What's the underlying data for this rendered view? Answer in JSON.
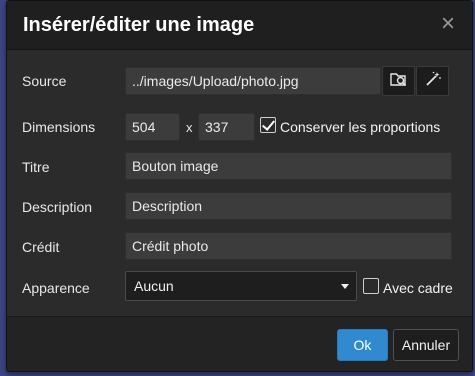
{
  "dialog": {
    "title": "Insérer/éditer une image",
    "close_icon": "×"
  },
  "form": {
    "source": {
      "label": "Source",
      "value": "../images/Upload/photo.jpg",
      "browse_icon": "folder-search-icon",
      "magic_icon": "magic-wand-icon"
    },
    "dimensions": {
      "label": "Dimensions",
      "width": "504",
      "separator": "x",
      "height": "337",
      "keep_ratio_label": "Conserver les proportions",
      "keep_ratio_checked": true
    },
    "title": {
      "label": "Titre",
      "value": "Bouton image"
    },
    "description": {
      "label": "Description",
      "value": "Description"
    },
    "credit": {
      "label": "Crédit",
      "value": "Crédit photo"
    },
    "appearance": {
      "label": "Apparence",
      "selected": "Aucun",
      "frame_label": "Avec cadre",
      "frame_checked": false
    }
  },
  "footer": {
    "ok_label": "Ok",
    "cancel_label": "Annuler"
  },
  "colors": {
    "backdrop": "#3a4784",
    "primary_button": "#2f8ad0",
    "dialog_background": "#2b2b2b"
  }
}
